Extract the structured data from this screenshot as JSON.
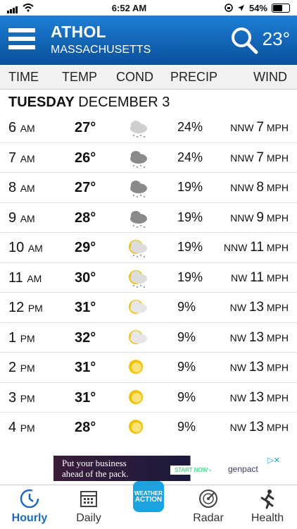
{
  "status_bar": {
    "time": "6:52 AM",
    "battery": "54%"
  },
  "header": {
    "city": "ATHOL",
    "state": "MASSACHUSETTS",
    "current_temp": "23°"
  },
  "columns": {
    "time": "TIME",
    "temp": "TEMP",
    "cond": "COND",
    "precip": "PRECIP",
    "wind": "WIND"
  },
  "day": {
    "weekday": "TUESDAY",
    "date": "DECEMBER 3"
  },
  "hours": [
    {
      "hour": "6",
      "ampm": "AM",
      "temp": "27°",
      "cond": "cloud-snow-icon",
      "precip": "24%",
      "dir": "NNW",
      "speed": "7",
      "unit": "MPH"
    },
    {
      "hour": "7",
      "ampm": "AM",
      "temp": "26°",
      "cond": "dark-cloud-snow-icon",
      "precip": "24%",
      "dir": "NNW",
      "speed": "7",
      "unit": "MPH"
    },
    {
      "hour": "8",
      "ampm": "AM",
      "temp": "27°",
      "cond": "dark-cloud-snow-icon",
      "precip": "19%",
      "dir": "NNW",
      "speed": "8",
      "unit": "MPH"
    },
    {
      "hour": "9",
      "ampm": "AM",
      "temp": "28°",
      "cond": "dark-cloud-snow-icon",
      "precip": "19%",
      "dir": "NNW",
      "speed": "9",
      "unit": "MPH"
    },
    {
      "hour": "10",
      "ampm": "AM",
      "temp": "29°",
      "cond": "sun-cloud-snow-icon",
      "precip": "19%",
      "dir": "NNW",
      "speed": "11",
      "unit": "MPH"
    },
    {
      "hour": "11",
      "ampm": "AM",
      "temp": "30°",
      "cond": "sun-cloud-snow-icon",
      "precip": "19%",
      "dir": "NW",
      "speed": "11",
      "unit": "MPH"
    },
    {
      "hour": "12",
      "ampm": "PM",
      "temp": "31°",
      "cond": "partly-cloudy-icon",
      "precip": "9%",
      "dir": "NW",
      "speed": "13",
      "unit": "MPH"
    },
    {
      "hour": "1",
      "ampm": "PM",
      "temp": "32°",
      "cond": "partly-cloudy-icon",
      "precip": "9%",
      "dir": "NW",
      "speed": "13",
      "unit": "MPH"
    },
    {
      "hour": "2",
      "ampm": "PM",
      "temp": "31°",
      "cond": "sunny-icon",
      "precip": "9%",
      "dir": "NW",
      "speed": "13",
      "unit": "MPH"
    },
    {
      "hour": "3",
      "ampm": "PM",
      "temp": "31°",
      "cond": "sunny-icon",
      "precip": "9%",
      "dir": "NW",
      "speed": "13",
      "unit": "MPH"
    },
    {
      "hour": "4",
      "ampm": "PM",
      "temp": "28°",
      "cond": "sunny-icon",
      "precip": "9%",
      "dir": "NW",
      "speed": "13",
      "unit": "MPH"
    }
  ],
  "ad": {
    "line1": "Put your business",
    "line2": "ahead of the pack.",
    "cta": "START NOW ›",
    "brand": "genpact"
  },
  "tabs": {
    "hourly": "Hourly",
    "daily": "Daily",
    "action_line1": "WEATHER",
    "action_line2": "ACTION",
    "radar": "Radar",
    "health": "Health"
  },
  "colors": {
    "header_top": "#1d7fd6",
    "header_bottom": "#0a4f9a",
    "active_tab": "#1c69c4",
    "action_tile": "#1aa3de"
  }
}
